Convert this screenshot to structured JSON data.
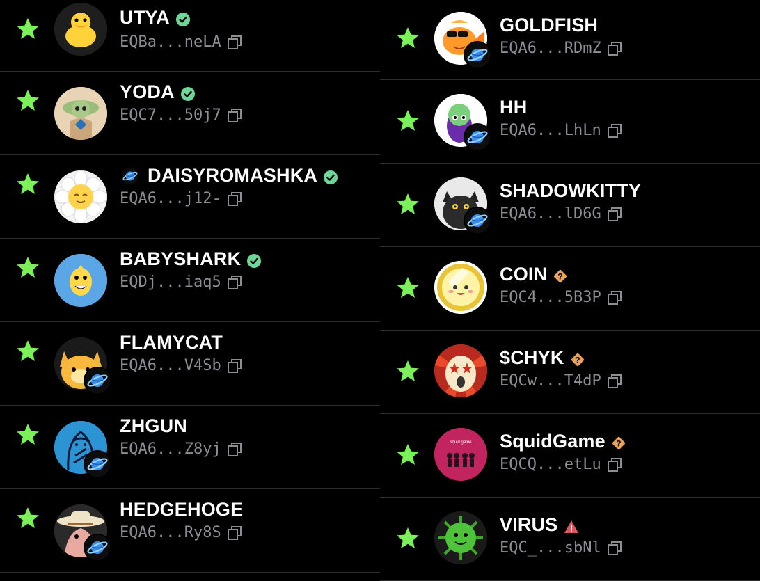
{
  "colors": {
    "star": "#7cf05a",
    "verified": "#6fd69a",
    "unverified": "#e8a25a",
    "warning": "#e0555a",
    "address": "#8d8d93"
  },
  "left": [
    {
      "name": "UTYA",
      "prefix": "",
      "badge": "verified-icon",
      "address": "EQBa...neLA",
      "avatar": "duck",
      "planet": false
    },
    {
      "name": "YODA",
      "prefix": "",
      "badge": "verified-icon",
      "address": "EQC7...50j7",
      "avatar": "yoda",
      "planet": false
    },
    {
      "name": "DAISYROMASHKA",
      "prefix": "planet-icon",
      "badge": "verified-icon",
      "address": "EQA6...j12-",
      "avatar": "daisy",
      "planet": false
    },
    {
      "name": "BABYSHARK",
      "prefix": "",
      "badge": "verified-icon",
      "address": "EQDj...iaq5",
      "avatar": "shark",
      "planet": false
    },
    {
      "name": "FLAMYCAT",
      "prefix": "",
      "badge": "",
      "address": "EQA6...V4Sb",
      "avatar": "cat",
      "planet": true
    },
    {
      "name": "ZHGUN",
      "prefix": "",
      "badge": "",
      "address": "EQA6...Z8yj",
      "avatar": "zhgun",
      "planet": true
    },
    {
      "name": "HEDGEHOGE",
      "prefix": "",
      "badge": "",
      "address": "EQA6...Ry8S",
      "avatar": "hedgehog",
      "planet": true
    }
  ],
  "right": [
    {
      "name": "GOLDFISH",
      "prefix": "",
      "badge": "",
      "address": "EQA6...RDmZ",
      "avatar": "goldfish",
      "planet": true
    },
    {
      "name": "HH",
      "prefix": "",
      "badge": "",
      "address": "EQA6...LhLn",
      "avatar": "eggplant",
      "planet": true
    },
    {
      "name": "SHADOWKITTY",
      "prefix": "",
      "badge": "",
      "address": "EQA6...lD6G",
      "avatar": "kitty",
      "planet": true
    },
    {
      "name": "COIN",
      "prefix": "",
      "badge": "unverified-icon",
      "address": "EQC4...5B3P",
      "avatar": "coin",
      "planet": false
    },
    {
      "name": "$CHYK",
      "prefix": "",
      "badge": "unverified-icon",
      "address": "EQCw...T4dP",
      "avatar": "chyk",
      "planet": false
    },
    {
      "name": "SquidGame",
      "prefix": "",
      "badge": "unverified-icon",
      "address": "EQCQ...etLu",
      "avatar": "squid",
      "planet": false
    },
    {
      "name": "VIRUS",
      "prefix": "",
      "badge": "warning-icon",
      "address": "EQC_...sbNl",
      "avatar": "virus",
      "planet": false
    }
  ]
}
